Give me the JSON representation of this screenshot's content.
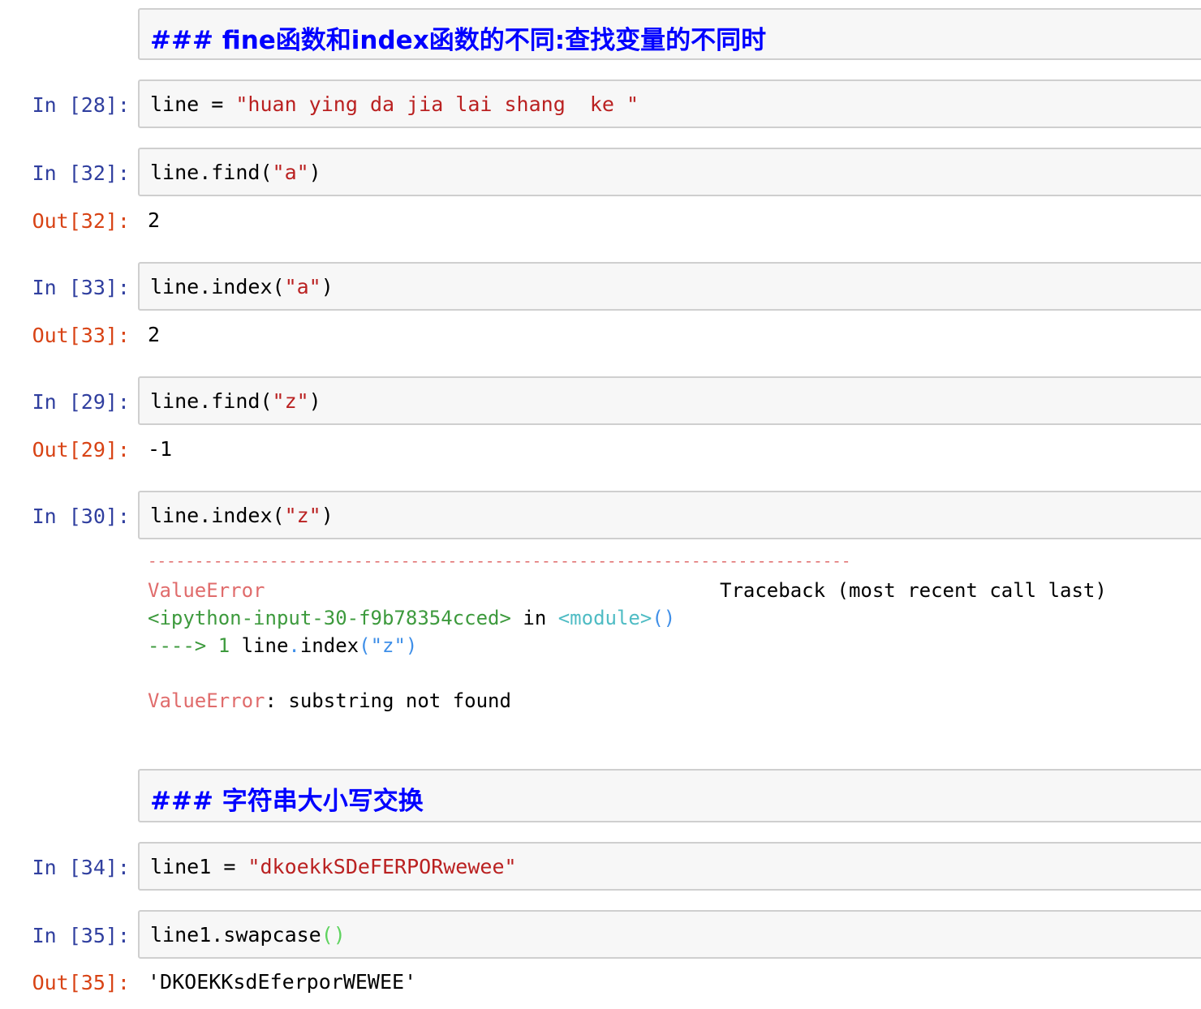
{
  "cells": {
    "md1": {
      "text": "### fine函数和index函数的不同:查找变量的不同时"
    },
    "c28": {
      "prompt": "In [28]:",
      "code_var": "line",
      "code_op": " = ",
      "code_str": "\"huan ying da jia lai shang  ke \""
    },
    "c32": {
      "prompt": "In [32]:",
      "code_pre": "line.find(",
      "code_str": "\"a\"",
      "code_post": ")",
      "out_prompt": "Out[32]:",
      "out_value": "2"
    },
    "c33": {
      "prompt": "In [33]:",
      "code_pre": "line.index(",
      "code_str": "\"a\"",
      "code_post": ")",
      "out_prompt": "Out[33]:",
      "out_value": "2"
    },
    "c29": {
      "prompt": "In [29]:",
      "code_pre": "line.find(",
      "code_str": "\"z\"",
      "code_post": ")",
      "out_prompt": "Out[29]:",
      "out_value": "-1"
    },
    "c30": {
      "prompt": "In [30]:",
      "code_pre": "line.index(",
      "code_str": "\"z\"",
      "code_post": ")",
      "traceback": {
        "dashes": "---------------------------------------------------------------------------",
        "error_type": "ValueError",
        "tb_header": "Traceback (most recent call last)",
        "input_ref": "<ipython-input-30-f9b78354cced>",
        "in_word": " in ",
        "module_ref": "<module>",
        "module_parens": "()",
        "arrow": "---->",
        "line_no": " 1",
        "tb_code_a": " line",
        "tb_dot": ".",
        "tb_code_b": "index",
        "tb_paren_open": "(",
        "tb_str": "\"z\"",
        "tb_paren_close": ")",
        "err_name": "ValueError",
        "err_msg": ": substring not found"
      }
    },
    "md2": {
      "text": "### 字符串大小写交换"
    },
    "c34": {
      "prompt": "In [34]:",
      "code_var": "line1",
      "code_op": " = ",
      "code_str": "\"dkoekkSDeFERPORwewee\""
    },
    "c35": {
      "prompt": "In [35]:",
      "code_pre": "line1.swapcase",
      "code_parens": "()",
      "out_prompt": "Out[35]:",
      "out_value": "'DKOEKKsdEferporWEWEE'"
    }
  },
  "colors": {
    "prompt_in": "#303f9f",
    "prompt_out": "#d84315",
    "string": "#ba2121",
    "heading": "#0000ff",
    "cell_bg": "#f7f7f7",
    "cell_border": "#cfcfcf"
  }
}
